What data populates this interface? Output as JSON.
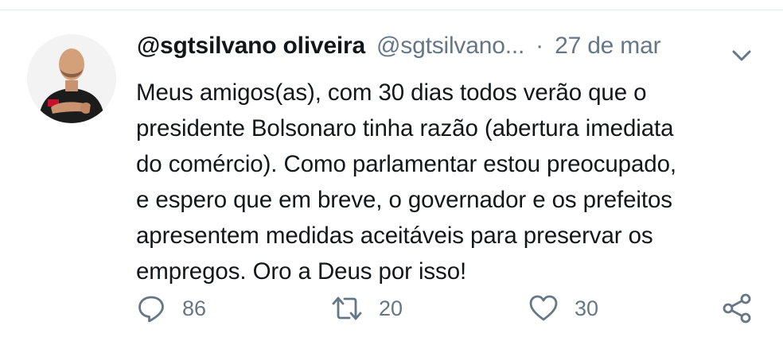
{
  "tweet": {
    "display_name": "@sgtsilvano oliveira",
    "handle": "@sgtsilvano...",
    "separator": "·",
    "date": "27 de mar",
    "text": "Meus amigos(as), com 30 dias todos verão que o\npresidente Bolsonaro tinha razão (abertura imediata\ndo comércio). Como parlamentar estou preocupado,\ne espero que em breve, o governador e os prefeitos\napresentem medidas aceitáveis para preservar os\nempregos. Oro a Deus por isso!"
  },
  "actions": {
    "replies": "86",
    "retweets": "20",
    "likes": "30"
  },
  "icons": {
    "reply": "reply-icon",
    "retweet": "retweet-icon",
    "like": "heart-icon",
    "share": "share-icon",
    "menu": "chevron-down-icon"
  },
  "colors": {
    "text": "#14171a",
    "secondary": "#657786",
    "divider": "#e6ecf0"
  }
}
